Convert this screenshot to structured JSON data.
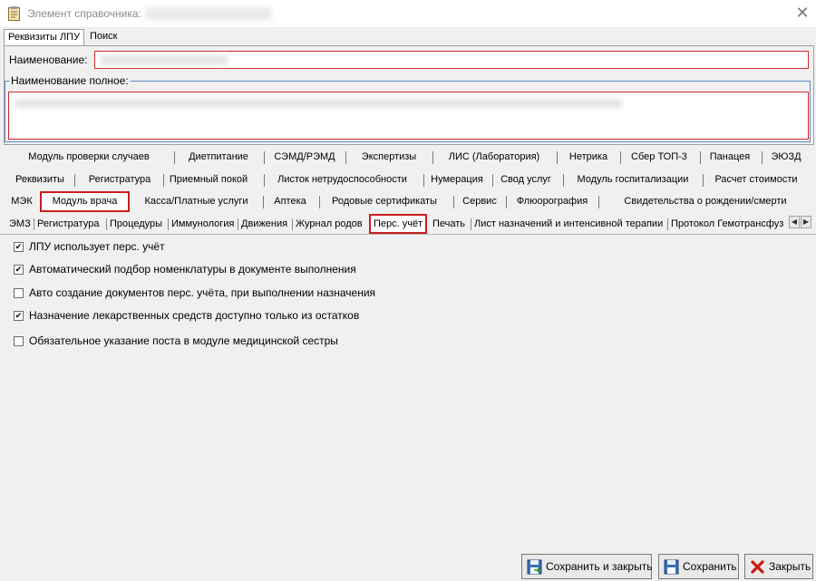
{
  "window": {
    "title": "Элемент справочника:"
  },
  "top_tabs": [
    {
      "label": "Реквизиты ЛПУ",
      "active": true
    },
    {
      "label": "Поиск",
      "active": false
    }
  ],
  "form": {
    "name_label": "Наименование:",
    "full_name_legend": "Наименование полное:"
  },
  "tab_rows": [
    [
      "Модуль проверки случаев",
      "Диетпитание",
      "СЭМД/РЭМД",
      "Экспертизы",
      "ЛИС (Лаборатория)",
      "Нетрика",
      "Сбер ТОП-3",
      "Панацея",
      "ЭЮЗД"
    ],
    [
      "Реквизиты",
      "Регистратура",
      "Приемный покой",
      "Листок нетрудоспособности",
      "Нумерация",
      "Свод услуг",
      "Модуль госпитализации",
      "Расчет стоимости"
    ],
    [
      "МЭК",
      "Модуль врача",
      "Касса/Платные услуги",
      "Аптека",
      "Родовые сертификаты",
      "Сервис",
      "Флюорография",
      "Свидетельства о рождении/смерти"
    ]
  ],
  "selected_main_tab": "Модуль врача",
  "sub_tabs": [
    "ЭМЗ",
    "Регистратура",
    "Процедуры",
    "Иммунология",
    "Движения",
    "Журнал родов",
    "Перс. учёт",
    "Печать",
    "Лист назначений и интенсивной терапии",
    "Протокол Гемотрансфуз"
  ],
  "selected_sub_tab": "Перс. учёт",
  "options": [
    {
      "label": "ЛПУ использует перс. учёт",
      "checked": true
    },
    {
      "label": "Автоматический подбор номенклатуры в документе выполнения",
      "checked": true
    },
    {
      "label": "Авто создание документов перс. учёта, при выполнении назначения",
      "checked": false
    },
    {
      "label": "Назначение лекарственных средств доступно только из остатков",
      "checked": true
    },
    {
      "label": "Обязательное указание поста в модуле медицинской сестры",
      "checked": false
    }
  ],
  "buttons": {
    "save_close": "Сохранить и закрыть",
    "save": "Сохранить",
    "close": "Закрыть"
  },
  "icons": {
    "title": "clipboard-icon",
    "close": "close-icon",
    "save_close": "floppy-arrow-icon",
    "save": "floppy-icon",
    "cancel": "red-x-icon"
  },
  "colors": {
    "highlight_border": "#c81e1e",
    "fieldset_border": "#5b8fc9"
  }
}
